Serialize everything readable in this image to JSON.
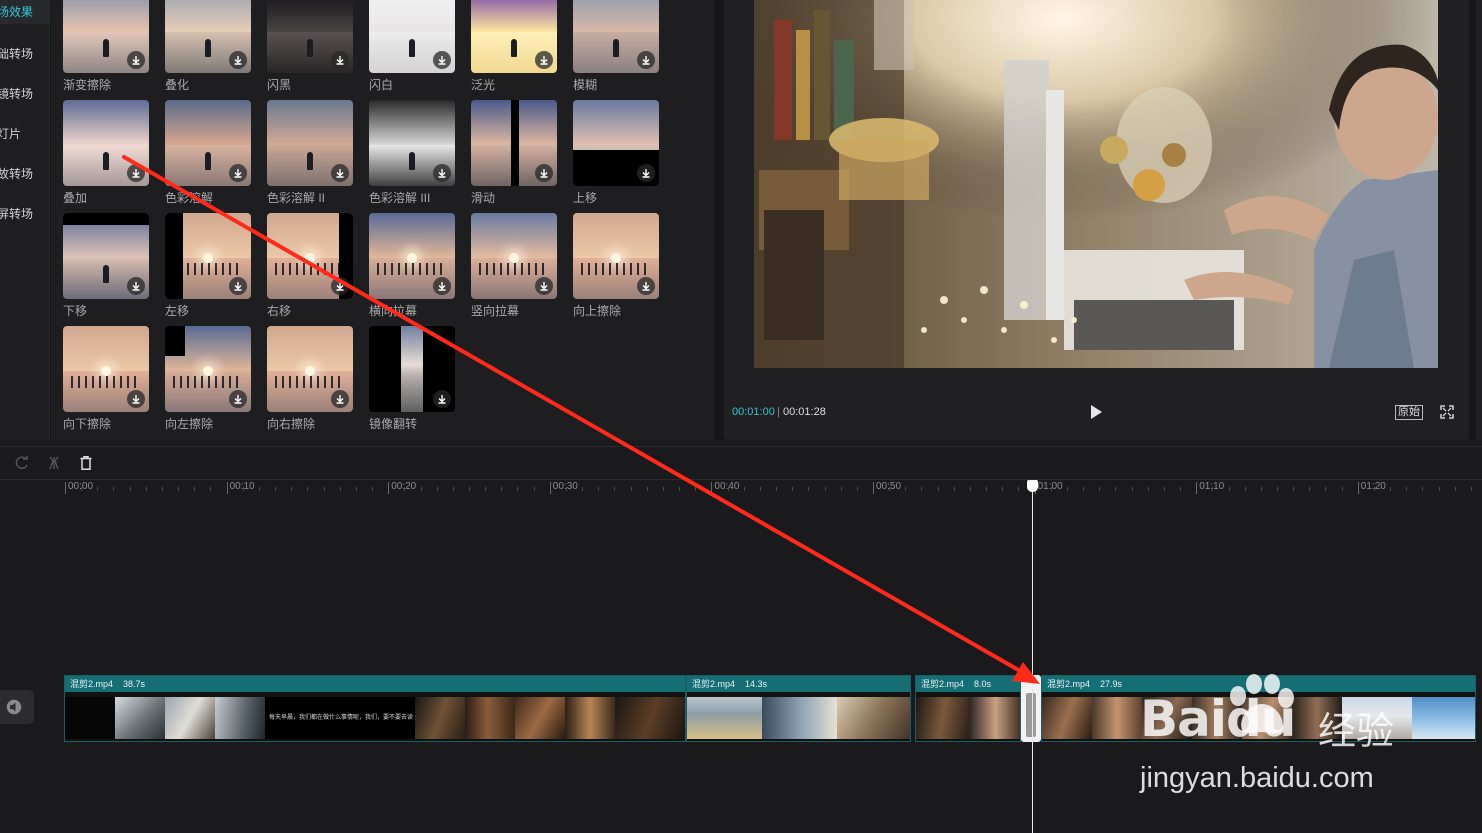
{
  "categories": [
    {
      "label": "场效果",
      "active": true
    },
    {
      "label": "础转场",
      "active": false
    },
    {
      "label": "镜转场",
      "active": false
    },
    {
      "label": "灯片",
      "active": false
    },
    {
      "label": "故转场",
      "active": false
    },
    {
      "label": "屏转场",
      "active": false
    }
  ],
  "effects": [
    {
      "label": "渐变擦除",
      "icon": "download-icon"
    },
    {
      "label": "叠化",
      "icon": "download-icon"
    },
    {
      "label": "闪黑",
      "icon": "download-icon"
    },
    {
      "label": "闪白",
      "icon": "download-icon"
    },
    {
      "label": "泛光",
      "icon": "download-icon"
    },
    {
      "label": "模糊",
      "icon": "download-icon"
    },
    {
      "label": "叠加",
      "icon": "download-icon"
    },
    {
      "label": "色彩溶解",
      "icon": "download-icon"
    },
    {
      "label": "色彩溶解 II",
      "icon": "download-icon"
    },
    {
      "label": "色彩溶解 III",
      "icon": "download-icon"
    },
    {
      "label": "滑动",
      "icon": "download-icon"
    },
    {
      "label": "上移",
      "icon": "download-icon"
    },
    {
      "label": "下移",
      "icon": "download-icon"
    },
    {
      "label": "左移",
      "icon": "download-icon"
    },
    {
      "label": "右移",
      "icon": "download-icon"
    },
    {
      "label": "横向拉幕",
      "icon": "download-icon"
    },
    {
      "label": "竖向拉幕",
      "icon": "download-icon"
    },
    {
      "label": "向上擦除",
      "icon": "download-icon"
    },
    {
      "label": "向下擦除",
      "icon": "download-icon"
    },
    {
      "label": "向左擦除",
      "icon": "download-icon"
    },
    {
      "label": "向右擦除",
      "icon": "download-icon"
    },
    {
      "label": "镜像翻转",
      "icon": "download-icon"
    }
  ],
  "preview": {
    "current_time": "00:01:00",
    "total_time": "00:01:28",
    "ratio_label": "原始"
  },
  "timeline": {
    "ruler": [
      "00:00",
      "00:10",
      "00:20",
      "00:30",
      "00:40",
      "00:50",
      "01:00",
      "01:10",
      "01:20"
    ],
    "clips": [
      {
        "name": "混剪2.mp4",
        "duration": "38.7s"
      },
      {
        "name": "混剪2.mp4",
        "duration": "14.3s"
      },
      {
        "name": "混剪2.mp4",
        "duration": "8.0s"
      },
      {
        "name": "混剪2.mp4",
        "duration": "27.9s"
      }
    ],
    "subtitle_snippet": "每天早晨，我们都在做什么事情呢，我们，要不要去读"
  },
  "watermark": {
    "brand": "Baidu",
    "product": "经验",
    "url": "jingyan.baidu.com"
  },
  "colors": {
    "accent": "#36c4d4",
    "clip_header": "#146e74",
    "annotation_arrow": "#ff2a1a"
  }
}
